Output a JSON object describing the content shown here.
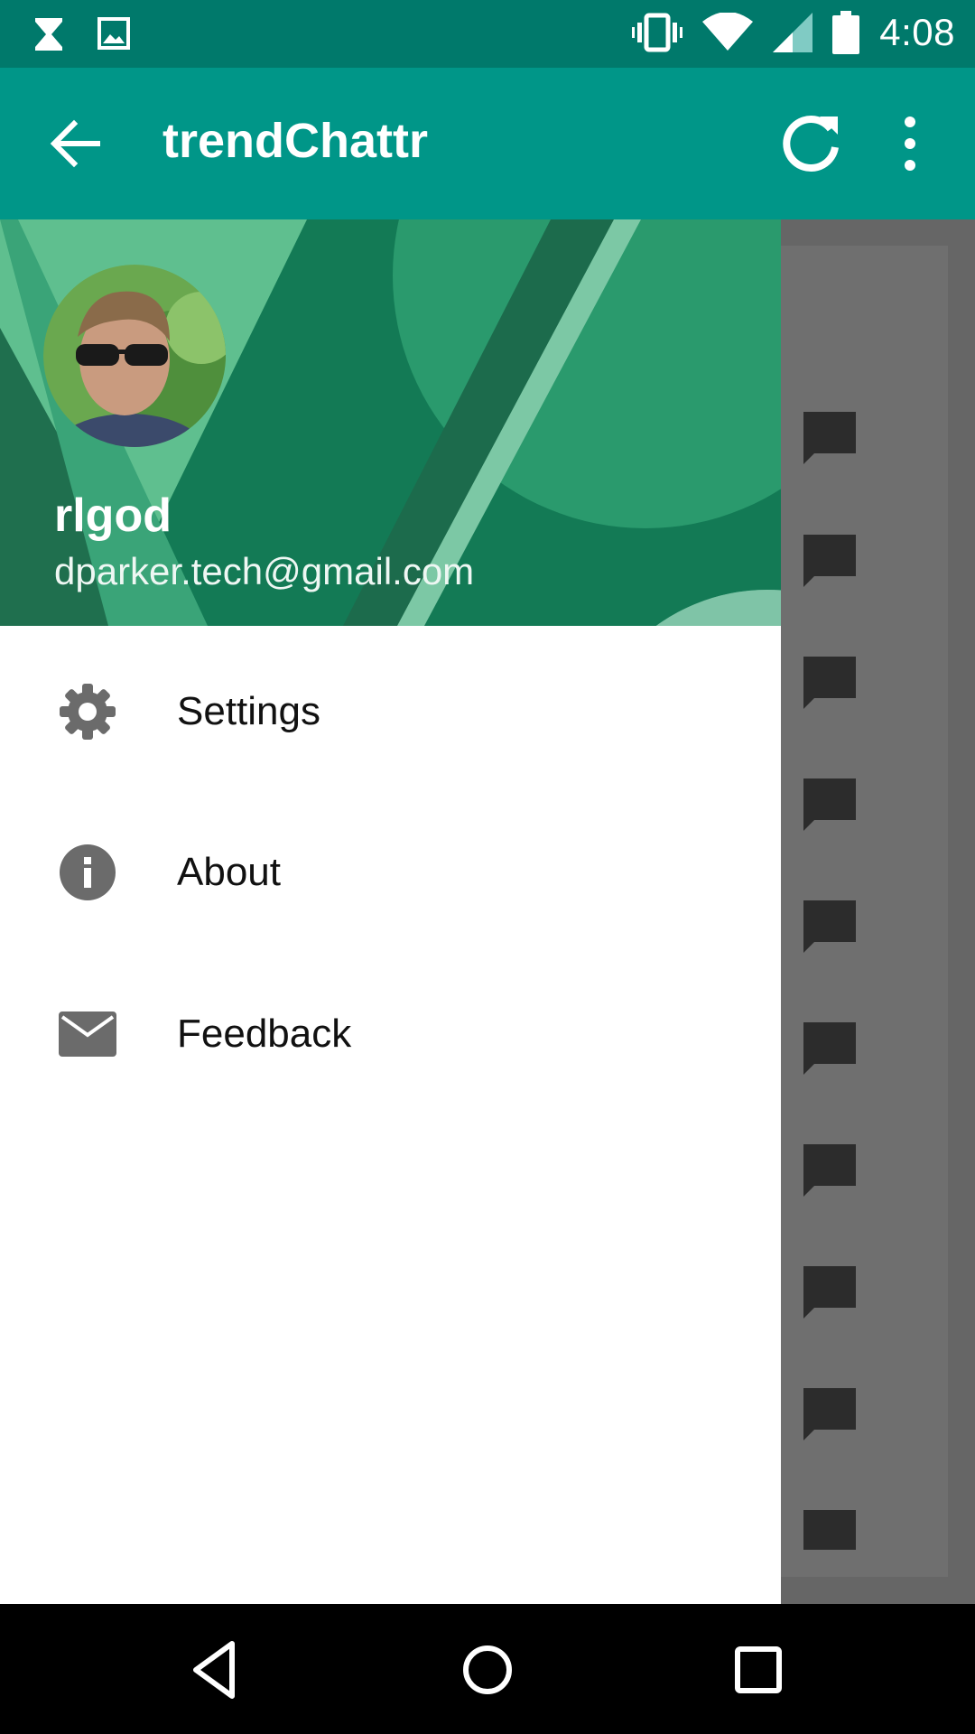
{
  "status_bar": {
    "time": "4:08",
    "left_icons": [
      "hourglass-icon",
      "image-icon"
    ],
    "right_icons": [
      "vibrate-icon",
      "wifi-icon",
      "cellular-signal-icon",
      "battery-icon"
    ]
  },
  "app_bar": {
    "title": "trendChattr",
    "actions": [
      "back-arrow-icon",
      "refresh-icon",
      "overflow-menu-icon"
    ]
  },
  "drawer": {
    "header": {
      "username": "rlgod",
      "email": "dparker.tech@gmail.com"
    },
    "items": [
      {
        "label": "Settings",
        "icon": "gear-icon"
      },
      {
        "label": "About",
        "icon": "info-icon"
      },
      {
        "label": "Feedback",
        "icon": "mail-icon"
      }
    ]
  },
  "background_list": {
    "icon": "chat-bubble-icon"
  },
  "nav_bar": {
    "buttons": [
      "back-triangle-icon",
      "home-circle-icon",
      "recents-square-icon"
    ]
  },
  "colors": {
    "status_bar": "#00796b",
    "app_bar": "#009688",
    "drawer_header": "#137a55",
    "scrim": "#666666",
    "nav_bar": "#000000"
  }
}
